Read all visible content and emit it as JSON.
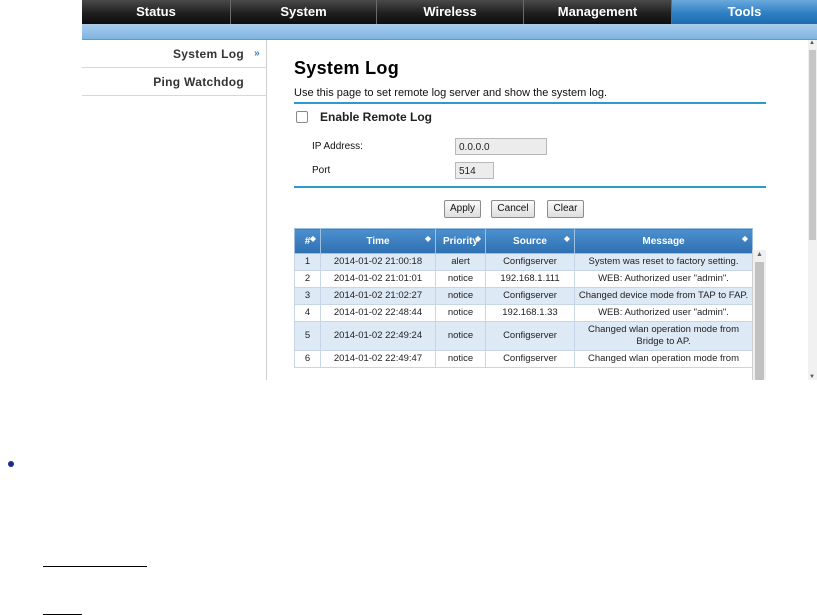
{
  "topnav": [
    {
      "label": "Status",
      "active": false
    },
    {
      "label": "System",
      "active": false
    },
    {
      "label": "Wireless",
      "active": false
    },
    {
      "label": "Management",
      "active": false
    },
    {
      "label": "Tools",
      "active": true
    }
  ],
  "sidebar": {
    "items": [
      {
        "label": "System Log",
        "active": true
      },
      {
        "label": "Ping Watchdog",
        "active": false
      }
    ]
  },
  "main": {
    "title": "System Log",
    "description": "Use this page to set remote log server and show the system log.",
    "enable_remote_label": "Enable Remote Log",
    "enable_remote_checked": false,
    "ip_label": "IP Address:",
    "ip_value": "0.0.0.0",
    "port_label": "Port",
    "port_value": "514",
    "buttons": {
      "apply": "Apply",
      "cancel": "Cancel",
      "clear": "Clear"
    }
  },
  "log_table": {
    "columns": [
      "#",
      "Time",
      "Priority",
      "Source",
      "Message"
    ],
    "rows": [
      [
        "1",
        "2014-01-02 21:00:18",
        "alert",
        "Configserver",
        "System was reset to factory setting."
      ],
      [
        "2",
        "2014-01-02 21:01:01",
        "notice",
        "192.168.1.111",
        "WEB: Authorized user \"admin\"."
      ],
      [
        "3",
        "2014-01-02 21:02:27",
        "notice",
        "Configserver",
        "Changed device mode from TAP to FAP."
      ],
      [
        "4",
        "2014-01-02 22:48:44",
        "notice",
        "192.168.1.33",
        "WEB: Authorized user \"admin\"."
      ],
      [
        "5",
        "2014-01-02 22:49:24",
        "notice",
        "Configserver",
        "Changed wlan operation mode from Bridge to AP."
      ],
      [
        "6",
        "2014-01-02 22:49:47",
        "notice",
        "Configserver",
        "Changed wlan operation mode from"
      ]
    ]
  },
  "icons": {
    "sort": "sort-icon",
    "sidebar_active": "double-chevron-right-icon",
    "bullet": "bullet-icon"
  },
  "colors": {
    "accent": "#2f7fc3",
    "header_blue": "#2d6fb0",
    "row_tint": "#dde9f5",
    "rule": "#2a9ad0"
  }
}
